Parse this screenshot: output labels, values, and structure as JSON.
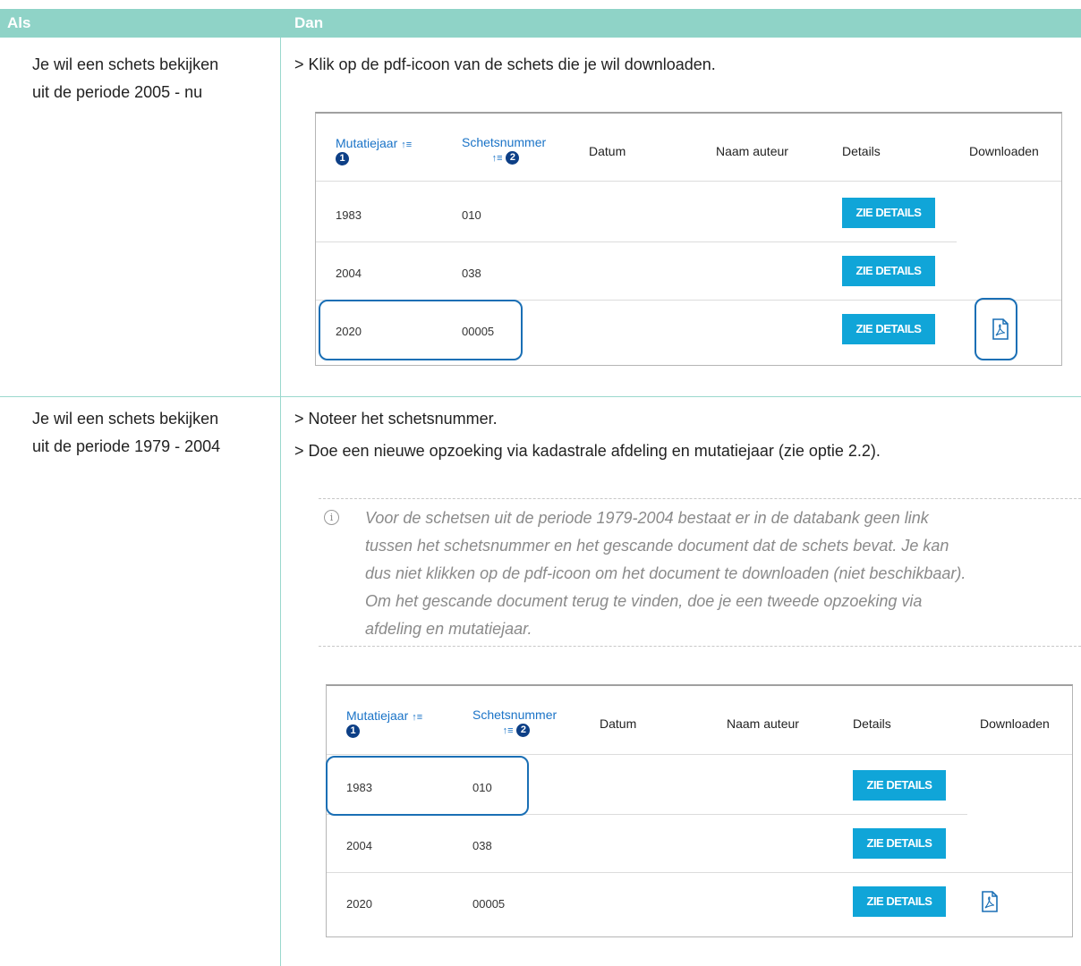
{
  "header": {
    "col1": "Als",
    "col2": "Dan"
  },
  "rows": [
    {
      "condition_line1": "Je wil een schets bekijken",
      "condition_line2": "uit de periode 2005 - nu",
      "steps": [
        "> Klik op de pdf-icoon van de schets die je wil downloaden."
      ]
    },
    {
      "condition_line1": "Je wil een schets bekijken",
      "condition_line2": "uit de periode 1979 - 2004",
      "steps": [
        "> Noteer het schetsnummer.",
        "> Doe een nieuwe opzoeking via kadastrale afdeling en mutatiejaar (zie optie 2.2)."
      ],
      "note_icon": "info-icon",
      "note_lines": [
        "Voor de schetsen uit de periode 1979-2004 bestaat er in de databank geen link",
        "tussen het schetsnummer en het gescande document dat de schets bevat. Je kan",
        "dus niet klikken op de pdf-icoon om het document te downloaden (niet beschikbaar).",
        "Om het gescande document terug te vinden, doe je een tweede opzoeking via",
        "afdeling en mutatiejaar."
      ]
    }
  ],
  "result_table": {
    "headers": {
      "mutatiejaar": "Mutatiejaar",
      "schetsnummer": "Schetsnummer",
      "datum": "Datum",
      "auteur": "Naam auteur",
      "details": "Details",
      "downloaden": "Downloaden"
    },
    "badge1": "1",
    "badge2": "2",
    "sort_glyph": "↑≡",
    "button_label": "ZIE DETAILS",
    "rows": [
      {
        "jaar": "1983",
        "nummer": "010"
      },
      {
        "jaar": "2004",
        "nummer": "038"
      },
      {
        "jaar": "2020",
        "nummer": "00005"
      }
    ]
  },
  "colors": {
    "header_bg": "#8fd3c7",
    "button": "#10a5d8",
    "highlight": "#1a6fb5",
    "badge": "#0d3f86"
  }
}
